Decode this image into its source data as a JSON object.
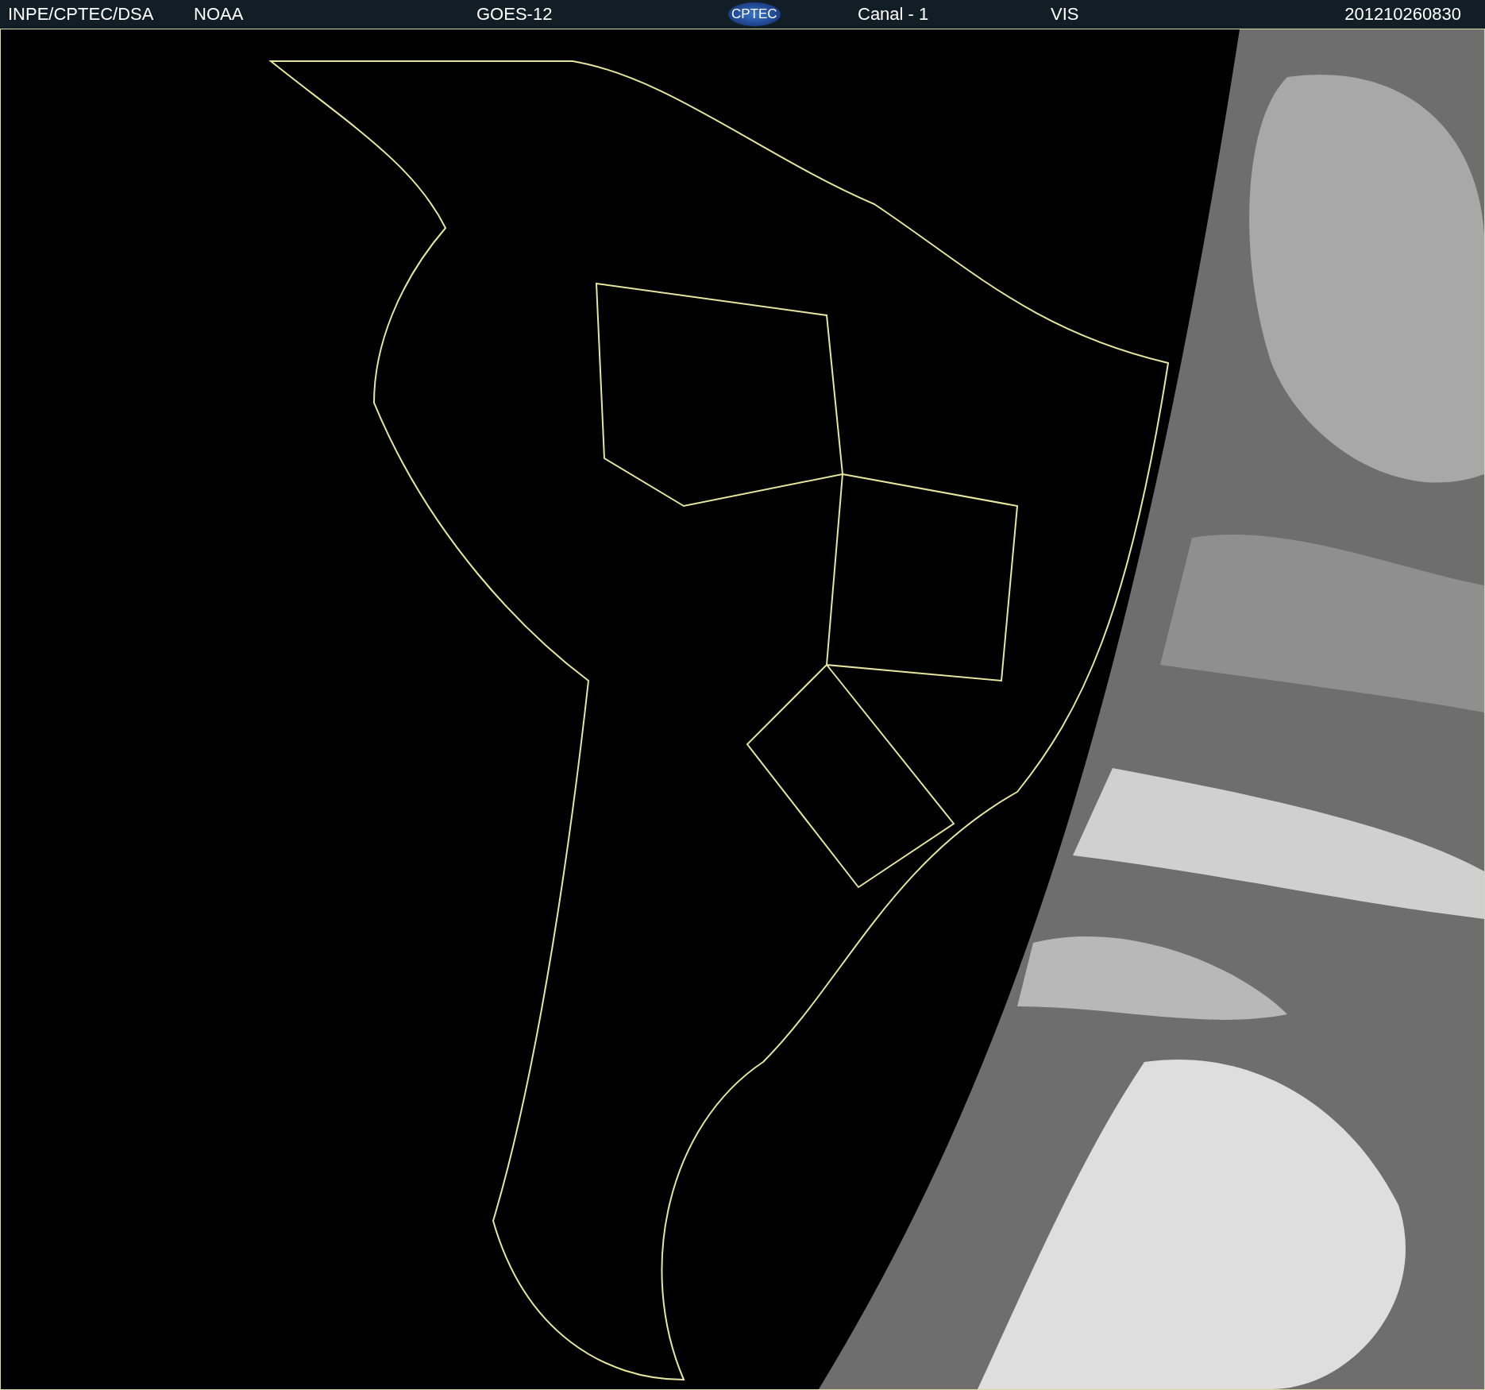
{
  "header": {
    "source": "INPE/CPTEC/DSA",
    "agency": "NOAA",
    "satellite": "GOES-12",
    "logo": "CPTEC",
    "channel": "Canal - 1",
    "band": "VIS",
    "timestamp": "201210260830"
  }
}
